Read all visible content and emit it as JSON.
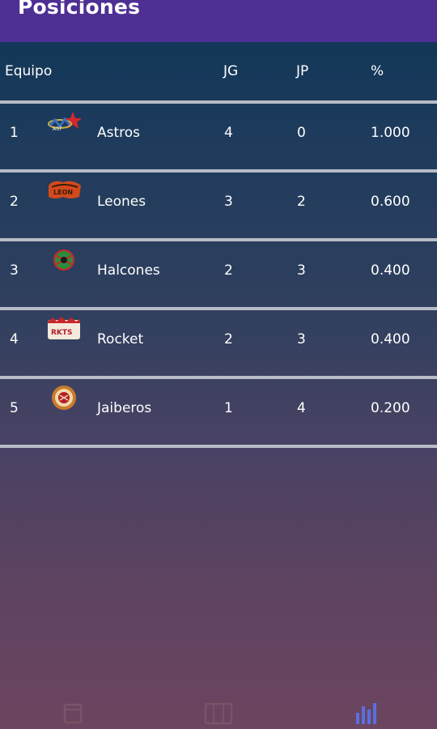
{
  "header": {
    "title": "Posiciones"
  },
  "table": {
    "columns": {
      "team": "Equipo",
      "jg": "JG",
      "jp": "JP",
      "pct": "%"
    },
    "rows": [
      {
        "pos": "1",
        "team": "Astros",
        "jg": "4",
        "jp": "0",
        "pct": "1.000",
        "logo_icon": "astros-logo-icon"
      },
      {
        "pos": "2",
        "team": "Leones",
        "jg": "3",
        "jp": "2",
        "pct": "0.600",
        "logo_icon": "leones-logo-icon"
      },
      {
        "pos": "3",
        "team": "Halcones",
        "jg": "2",
        "jp": "3",
        "pct": "0.400",
        "logo_icon": "halcones-logo-icon"
      },
      {
        "pos": "4",
        "team": "Rocket",
        "jg": "2",
        "jp": "3",
        "pct": "0.400",
        "logo_icon": "rocket-logo-icon"
      },
      {
        "pos": "5",
        "team": "Jaiberos",
        "jg": "1",
        "jp": "4",
        "pct": "0.200",
        "logo_icon": "jaiberos-logo-icon"
      }
    ]
  },
  "bottom_nav": {
    "items": [
      {
        "icon": "calendar-icon",
        "active": false
      },
      {
        "icon": "scoreboard-icon",
        "active": false
      },
      {
        "icon": "bar-chart-icon",
        "active": true
      }
    ]
  },
  "colors": {
    "header_bg": "#4e2f93",
    "divider": "#b7bcc6",
    "active_nav": "#5b6fe0",
    "inactive_nav": "#7a5466"
  }
}
